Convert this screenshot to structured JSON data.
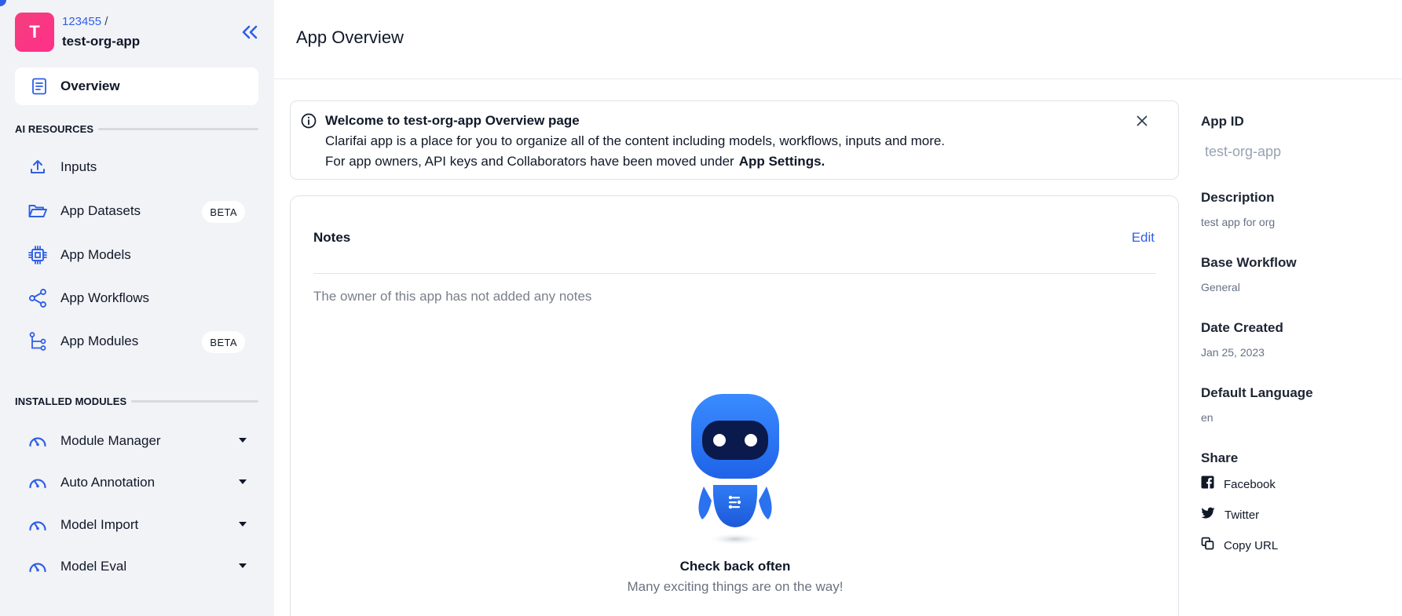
{
  "sidebar": {
    "org": {
      "avatar_letter": "T",
      "org_id": "123455",
      "separator": " /",
      "app_name": "test-org-app"
    },
    "overview_label": "Overview",
    "ai_resources": {
      "heading": "AI RESOURCES",
      "items": [
        {
          "label": "Inputs",
          "icon": "upload-icon",
          "badge": null
        },
        {
          "label": "App Datasets",
          "icon": "folder-open-icon",
          "badge": "BETA"
        },
        {
          "label": "App Models",
          "icon": "chip-icon",
          "badge": null
        },
        {
          "label": "App Workflows",
          "icon": "share-nodes-icon",
          "badge": null
        },
        {
          "label": "App Modules",
          "icon": "tree-branch-icon",
          "badge": "BETA"
        }
      ]
    },
    "installed_modules": {
      "heading": "INSTALLED MODULES",
      "items": [
        {
          "label": "Module Manager",
          "icon": "gauge-icon"
        },
        {
          "label": "Auto Annotation",
          "icon": "gauge-icon"
        },
        {
          "label": "Model Import",
          "icon": "gauge-icon"
        },
        {
          "label": "Model Eval",
          "icon": "gauge-icon"
        }
      ]
    }
  },
  "header": {
    "title": "App Overview"
  },
  "banner": {
    "title": "Welcome to test-org-app Overview page",
    "line1": "Clarifai app is a place for you to organize all of the content including models, workflows, inputs and more.",
    "line2": "For app owners, API keys and Collaborators have been moved under",
    "line2_bold": "App Settings."
  },
  "notes": {
    "title": "Notes",
    "edit_label": "Edit",
    "empty_text": "The owner of this app has not added any notes",
    "robot_title": "Check back often",
    "robot_subtitle": "Many exciting things are on the way!"
  },
  "details": {
    "app_id_label": "App ID",
    "app_id_value": "test-org-app",
    "description_label": "Description",
    "description_value": "test app for org",
    "base_workflow_label": "Base Workflow",
    "base_workflow_value": "General",
    "date_created_label": "Date Created",
    "date_created_value": "Jan 25, 2023",
    "default_language_label": "Default Language",
    "default_language_value": "en",
    "share_label": "Share",
    "share_items": [
      {
        "label": "Facebook",
        "icon": "facebook-icon"
      },
      {
        "label": "Twitter",
        "icon": "twitter-icon"
      },
      {
        "label": "Copy URL",
        "icon": "copy-icon"
      }
    ]
  },
  "colors": {
    "accent": "#2f5fe6",
    "avatar": "#f43f7d",
    "sidebar_bg": "#f2f3f7",
    "robot_blue": "#2f7cf6"
  }
}
